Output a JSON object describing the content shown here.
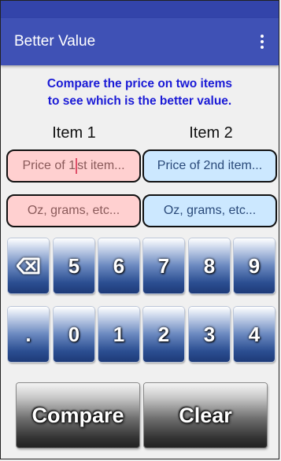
{
  "app": {
    "title": "Better Value"
  },
  "instructions": {
    "line1": "Compare the price on two items",
    "line2": "to see which is the better value."
  },
  "columns": {
    "item1": "Item 1",
    "item2": "Item 2"
  },
  "fields": {
    "price1_before_caret": "Price of 1",
    "price1_after_caret": "st item...",
    "price2": "Price of 2nd item...",
    "size1": "Oz, grams, etc...",
    "size2": "Oz, grams, etc..."
  },
  "keypad": {
    "row1": [
      "5",
      "6",
      "7",
      "8",
      "9"
    ],
    "row2": [
      ".",
      "0",
      "1",
      "2",
      "3",
      "4"
    ]
  },
  "actions": {
    "compare": "Compare",
    "clear": "Clear"
  },
  "colors": {
    "appbar": "#3f51b5",
    "instruction_text": "#1a1ad6",
    "item1_field": "#ffd0d0",
    "item2_field": "#cce8ff"
  },
  "icons": {
    "menu": "more-vert-icon",
    "backspace": "backspace-icon"
  }
}
